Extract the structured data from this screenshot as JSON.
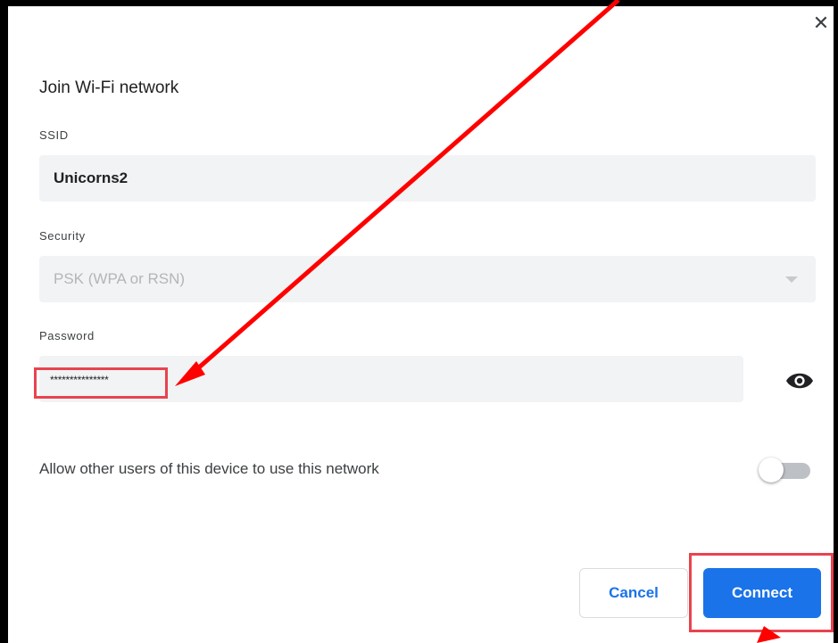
{
  "dialog": {
    "title": "Join Wi-Fi network",
    "close_symbol": "✕",
    "close_icon": "close-icon"
  },
  "ssid": {
    "label": "SSID",
    "value": "Unicorns2"
  },
  "security": {
    "label": "Security",
    "value": "PSK (WPA or RSN)",
    "disabled": true,
    "arrow_icon": "dropdown-arrow-icon"
  },
  "password": {
    "label": "Password",
    "value": "***************",
    "visibility_icon": "eye-icon"
  },
  "share": {
    "label": "Allow other users of this device to use this network",
    "enabled": false
  },
  "buttons": {
    "cancel": "Cancel",
    "connect": "Connect"
  },
  "colors": {
    "accent": "#1a73e8",
    "annotation": "#e8434f",
    "arrow": "#ff0000",
    "field_background": "#f1f3f4"
  }
}
